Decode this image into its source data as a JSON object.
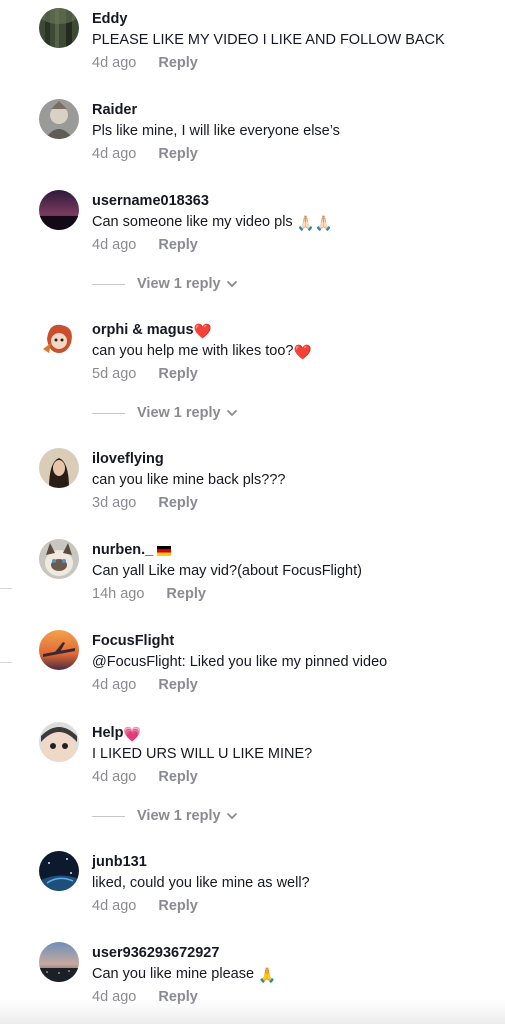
{
  "comments": [
    {
      "username": "Eddy",
      "text": "PLEASE LIKE MY VIDEO I LIKE AND FOLLOW BACK",
      "time": "4d ago",
      "reply_label": "Reply",
      "avatar": "forest-avatar"
    },
    {
      "username": "Raider",
      "text": "Pls like mine, I will like everyone else’s",
      "time": "4d ago",
      "reply_label": "Reply",
      "avatar": "character-avatar"
    },
    {
      "username": "username018363",
      "text": "Can someone like my video pls",
      "text_emoji": "🙏🏻🙏🏻",
      "time": "4d ago",
      "reply_label": "Reply",
      "avatar": "sunset-avatar",
      "view_replies": "View 1 reply"
    },
    {
      "username": "orphi & magus",
      "username_emoji": "❤️",
      "text": "can you help me with likes too?",
      "text_emoji": "❤️",
      "time": "5d ago",
      "reply_label": "Reply",
      "avatar": "anime-avatar",
      "view_replies": "View 1 reply"
    },
    {
      "username": "iloveflying",
      "text": "can you like mine back pls???",
      "time": "3d ago",
      "reply_label": "Reply",
      "avatar": "person-avatar"
    },
    {
      "username": "nurben._",
      "username_emoji": "🇩🇪",
      "text": "Can yall Like may vid?(about FocusFlight)",
      "time": "14h ago",
      "reply_label": "Reply",
      "avatar": "cat-avatar"
    },
    {
      "username": "FocusFlight",
      "text": "@FocusFlight: Liked you like my pinned video",
      "time": "4d ago",
      "reply_label": "Reply",
      "avatar": "airplane-avatar"
    },
    {
      "username": "Help",
      "username_emoji": "💗",
      "text": "I LIKED URS WILL U LIKE MINE?",
      "time": "4d ago",
      "reply_label": "Reply",
      "avatar": "face-avatar",
      "view_replies": "View 1 reply"
    },
    {
      "username": "junb131",
      "text": "liked, could you like mine as well?",
      "time": "4d ago",
      "reply_label": "Reply",
      "avatar": "space-avatar"
    },
    {
      "username": "user936293672927",
      "text": "Can you like mine please",
      "text_emoji": "🙏",
      "time": "4d ago",
      "reply_label": "Reply",
      "avatar": "cityscape-avatar"
    }
  ],
  "colors": {
    "text": "#161823",
    "muted": "#8a8b91",
    "divider": "#c7c8cc"
  }
}
